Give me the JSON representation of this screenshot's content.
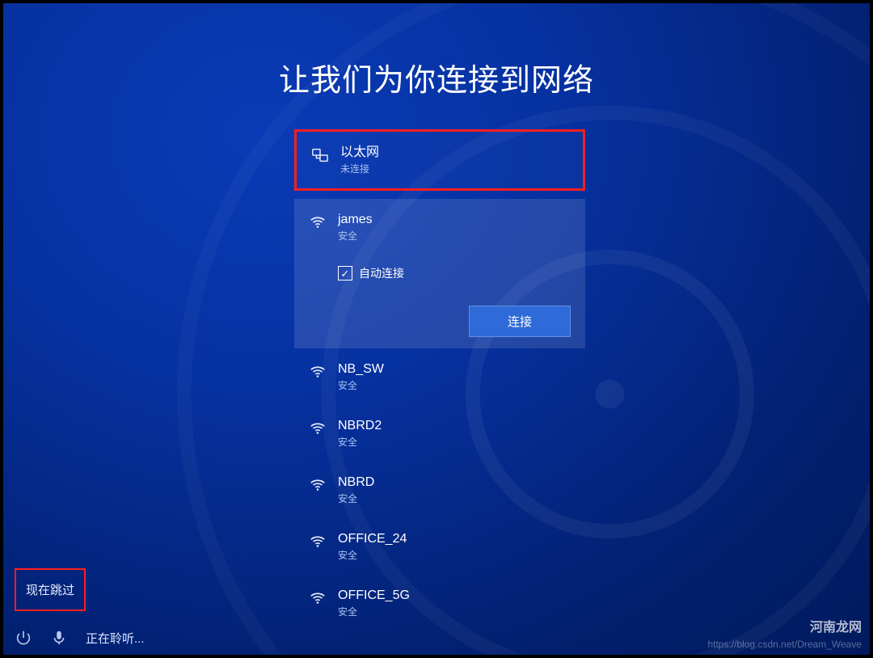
{
  "title": "让我们为你连接到网络",
  "ethernet": {
    "name": "以太网",
    "status": "未连接"
  },
  "selected_network": {
    "name": "james",
    "security": "安全",
    "auto_connect_label": "自动连接",
    "connect_label": "连接"
  },
  "networks": [
    {
      "name": "NB_SW",
      "security": "安全"
    },
    {
      "name": "NBRD2",
      "security": "安全"
    },
    {
      "name": "NBRD",
      "security": "安全"
    },
    {
      "name": "OFFICE_24",
      "security": "安全"
    },
    {
      "name": "OFFICE_5G",
      "security": "安全"
    }
  ],
  "skip_label": "现在跳过",
  "listening_label": "正在聆听...",
  "watermark_url": "https://blog.csdn.net/Dream_Weave",
  "watermark_brand": "河南龙网"
}
